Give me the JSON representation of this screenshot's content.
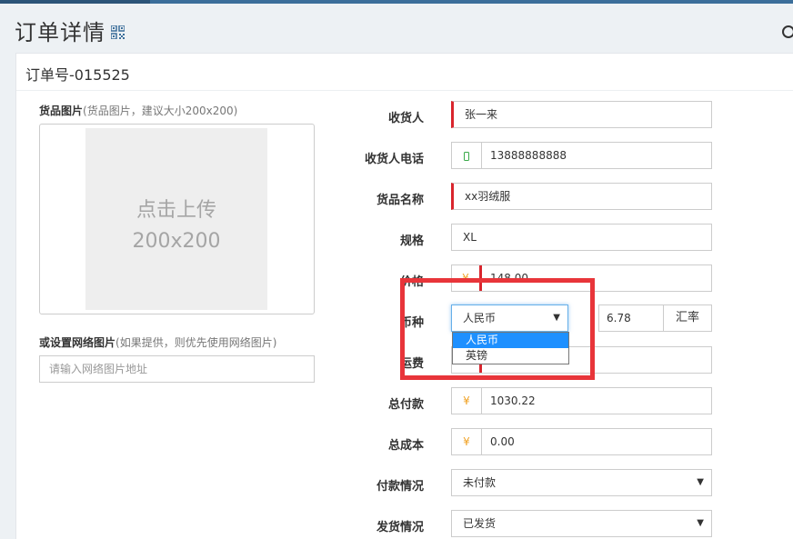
{
  "header": {
    "title": "订单详情",
    "qr_icon": "qrcode-icon",
    "right_icon": "circle-icon"
  },
  "order": {
    "number": "订单号-015525"
  },
  "image_section": {
    "label": "货品图片",
    "hint": "(货品图片，建议大小200x200)",
    "upload_line1": "点击上传",
    "upload_line2": "200x200",
    "net_label": "或设置网络图片",
    "net_hint": "(如果提供，则优先使用网络图片)",
    "net_placeholder": "请输入网络图片地址"
  },
  "form": {
    "consignee": {
      "label": "收货人",
      "value": "张一来"
    },
    "phone": {
      "label": "收货人电话",
      "value": "13888888888",
      "icon": "phone-icon"
    },
    "goods_name": {
      "label": "货品名称",
      "value": "xx羽绒服"
    },
    "spec": {
      "label": "规格",
      "value": "XL"
    },
    "price": {
      "label": "价格",
      "symbol": "¥",
      "value": "148.00"
    },
    "currency": {
      "label": "币种",
      "selected": "人民币",
      "options": [
        "人民币",
        "英镑"
      ],
      "rate": "6.78",
      "rate_button": "汇率"
    },
    "shipping": {
      "label": "运费",
      "symbol": "¥",
      "value": ""
    },
    "total_paid": {
      "label": "总付款",
      "symbol": "¥",
      "value": "1030.22"
    },
    "total_cost": {
      "label": "总成本",
      "symbol": "¥",
      "value": "0.00"
    },
    "payment": {
      "label": "付款情况",
      "selected": "未付款"
    },
    "delivery": {
      "label": "发货情况",
      "selected": "已发货"
    }
  },
  "colors": {
    "required": "#d9252d",
    "highlight": "#e8353a",
    "selected_option": "#1e90ff",
    "currency_symbol": "#f0a020"
  }
}
